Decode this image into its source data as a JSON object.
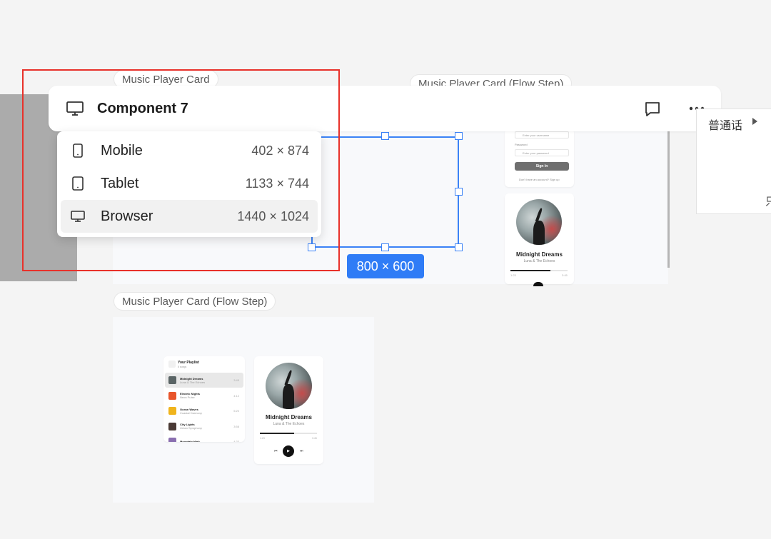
{
  "canvas": {
    "frames": [
      {
        "label": "Music Player Card"
      },
      {
        "label": "Music Player Card (Flow Step)"
      },
      {
        "label": "Music Player Card (Flow Step)"
      }
    ],
    "selection_size": "800 × 600"
  },
  "toolbar": {
    "title": "Component 7",
    "icons": [
      "monitor-icon",
      "comment-icon",
      "more-icon"
    ]
  },
  "device_menu": {
    "items": [
      {
        "label": "Mobile",
        "size": "402 × 874",
        "icon": "phone-icon"
      },
      {
        "label": "Tablet",
        "size": "1133 × 744",
        "icon": "tablet-icon"
      },
      {
        "label": "Browser",
        "size": "1440 × 1024",
        "icon": "monitor-icon",
        "selected": true
      }
    ]
  },
  "login_preview": {
    "email_placeholder": "Enter your username",
    "password_label": "Password",
    "password_placeholder": "Enter your password",
    "signin_label": "Sign In",
    "footer": "Don't have an account? Sign up"
  },
  "player_small": {
    "song": "Midnight Dreams",
    "artist": "Luna & The Echoes",
    "time_start": "1:23",
    "time_end": "3:45",
    "progress": 0.7
  },
  "playlist": {
    "title": "Your Playlist",
    "subtitle": "5 songs",
    "songs": [
      {
        "title": "Midnight Dreams",
        "artist": "Luna & The Echoes",
        "time": "3:45",
        "color": "#5a6465",
        "active": true
      },
      {
        "title": "Electric Nights",
        "artist": "Neon Pulse",
        "time": "4:12",
        "color": "#e8552b"
      },
      {
        "title": "Ocean Waves",
        "artist": "Coastal Harmony",
        "time": "5:20",
        "color": "#f0b41c"
      },
      {
        "title": "City Lights",
        "artist": "Urban Symphony",
        "time": "3:58",
        "color": "#4a3a35"
      },
      {
        "title": "Mountain High",
        "artist": "",
        "time": "4:33",
        "color": "#8a6fb0"
      }
    ]
  },
  "player_large": {
    "song": "Midnight Dreams",
    "artist": "Luna & The Echoes",
    "time_start": "1:23",
    "time_end": "3:45",
    "progress": 0.6
  },
  "side_panel": {
    "language": "普通话",
    "partial_char": "只"
  },
  "colors": {
    "selection": "#3b82f6",
    "highlight_border": "#e8312a"
  }
}
